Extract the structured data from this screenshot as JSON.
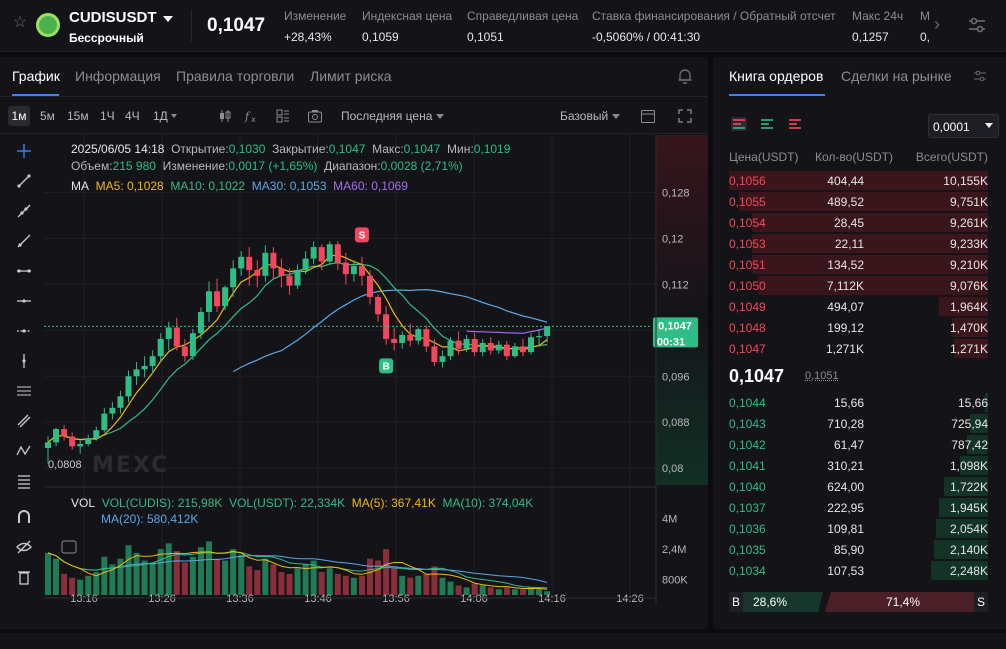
{
  "header": {
    "symbol": "CUDISUSDT",
    "contract_type": "Бессрочный",
    "last_price": "0,1047",
    "stats": [
      {
        "label": "Изменение",
        "value": "+28,43%",
        "color": "green"
      },
      {
        "label": "Индексная цена",
        "value": "0,1059",
        "color": "normal"
      },
      {
        "label": "Справедливая цена",
        "value": "0,1051",
        "color": "normal"
      },
      {
        "label": "Ставка финансирования / Обратный отсчет",
        "value": "-0,5060% / 00:41:30",
        "color": "normal"
      },
      {
        "label": "Макс 24ч",
        "value": "0,1257",
        "color": "normal"
      },
      {
        "label": "М",
        "value": "0,",
        "color": "normal"
      }
    ]
  },
  "left_tabs": [
    "График",
    "Информация",
    "Правила торговли",
    "Лимит риска"
  ],
  "toolbar": {
    "timeframes": [
      "1м",
      "5м",
      "15м",
      "1Ч",
      "4Ч",
      "1Д"
    ],
    "price_type": "Последняя цена",
    "view_mode": "Базовый"
  },
  "chart_info": {
    "line1": {
      "date": "2025/06/05 14:18",
      "open_label": "Открытие:",
      "open": "0,1030",
      "close_label": "Закрытие:",
      "close": "0,1047",
      "high_label": "Макс:",
      "high": "0,1047",
      "low_label": "Мин:",
      "low": "0,1019"
    },
    "line2": {
      "vol_label": "Объем:",
      "vol": "215 980",
      "chg_label": "Изменение:",
      "chg": "0,0017 (+1,65%)",
      "amp_label": "Диапазон:",
      "amp": "0,0028 (2,71%)"
    },
    "ma": {
      "label": "MA",
      "ma5": "MA5: 0,1028",
      "ma10": "MA10: 0,1022",
      "ma30": "MA30: 0,1053",
      "ma60": "MA60: 0,1069"
    },
    "vol_line1": {
      "label": "VOL",
      "vol_base": "VOL(CUDIS): 215,98K",
      "vol_quote": "VOL(USDT): 22,334K",
      "ma5": "MA(5): 367,41K",
      "ma10": "MA(10): 374,04K"
    },
    "vol_line2": {
      "ma20": "MA(20): 580,412K"
    },
    "watermark": "MEXC",
    "current_price_tag": "0,1047",
    "countdown_tag": "00:31",
    "low_marker": "0,0808",
    "sell_marker": "S",
    "buy_marker": "B"
  },
  "chart_data": {
    "type": "candlestick",
    "y_ticks": [
      "0,128",
      "0,12",
      "0,112",
      "0,104",
      "0,096",
      "0,088",
      "0,08"
    ],
    "y_tick_values": [
      0.128,
      0.12,
      0.112,
      0.104,
      0.096,
      0.088,
      0.08
    ],
    "vol_ticks": [
      "4M",
      "2,4M",
      "800K"
    ],
    "x_ticks": [
      "13:16",
      "13:26",
      "13:36",
      "13:46",
      "13:56",
      "14:06",
      "14:16",
      "14:26"
    ],
    "ylim": [
      0.0788,
      0.1328
    ],
    "candles": [
      [
        0.0835,
        0.0855,
        0.0845,
        0.0808
      ],
      [
        0.0845,
        0.087,
        0.0868,
        0.0838
      ],
      [
        0.0868,
        0.0875,
        0.0855,
        0.0848
      ],
      [
        0.0855,
        0.0862,
        0.0838,
        0.0832
      ],
      [
        0.0838,
        0.0848,
        0.0842,
        0.0825
      ],
      [
        0.0842,
        0.0858,
        0.0852,
        0.0838
      ],
      [
        0.0852,
        0.0872,
        0.0866,
        0.0848
      ],
      [
        0.0866,
        0.0905,
        0.0895,
        0.0862
      ],
      [
        0.0895,
        0.0915,
        0.0905,
        0.0885
      ],
      [
        0.0905,
        0.0935,
        0.0925,
        0.0895
      ],
      [
        0.0925,
        0.097,
        0.096,
        0.0915
      ],
      [
        0.096,
        0.0985,
        0.0972,
        0.0945
      ],
      [
        0.0972,
        0.0995,
        0.0978,
        0.0958
      ],
      [
        0.0978,
        0.1005,
        0.0995,
        0.0965
      ],
      [
        0.0995,
        0.1035,
        0.1025,
        0.0985
      ],
      [
        0.1025,
        0.1055,
        0.1045,
        0.1005
      ],
      [
        0.1045,
        0.1062,
        0.1012,
        0.1005
      ],
      [
        0.1012,
        0.1025,
        0.0995,
        0.0985
      ],
      [
        0.0995,
        0.1042,
        0.1035,
        0.0988
      ],
      [
        0.1035,
        0.108,
        0.1072,
        0.1025
      ],
      [
        0.1072,
        0.1125,
        0.1108,
        0.1055
      ],
      [
        0.1108,
        0.113,
        0.1082,
        0.1072
      ],
      [
        0.1082,
        0.1118,
        0.1115,
        0.1075
      ],
      [
        0.1115,
        0.1162,
        0.1148,
        0.1098
      ],
      [
        0.1148,
        0.1178,
        0.1168,
        0.1135
      ],
      [
        0.1168,
        0.1185,
        0.1145,
        0.1118
      ],
      [
        0.1145,
        0.1162,
        0.1135,
        0.1115
      ],
      [
        0.1135,
        0.1188,
        0.1175,
        0.1125
      ],
      [
        0.1175,
        0.1185,
        0.1148,
        0.1128
      ],
      [
        0.1148,
        0.1165,
        0.1135,
        0.1115
      ],
      [
        0.1135,
        0.1148,
        0.1118,
        0.1102
      ],
      [
        0.1118,
        0.1155,
        0.1145,
        0.1112
      ],
      [
        0.1145,
        0.1178,
        0.1165,
        0.1138
      ],
      [
        0.1165,
        0.1195,
        0.1185,
        0.1155
      ],
      [
        0.1185,
        0.119,
        0.116,
        0.1145
      ],
      [
        0.116,
        0.1195,
        0.119,
        0.1155
      ],
      [
        0.119,
        0.1195,
        0.1158,
        0.1145
      ],
      [
        0.1158,
        0.1175,
        0.1138,
        0.112
      ],
      [
        0.1138,
        0.1162,
        0.1152,
        0.1125
      ],
      [
        0.1152,
        0.1168,
        0.1135,
        0.1118
      ],
      [
        0.1135,
        0.1145,
        0.1098,
        0.1085
      ],
      [
        0.1098,
        0.1102,
        0.1068,
        0.1055
      ],
      [
        0.1068,
        0.1082,
        0.1025,
        0.1015
      ],
      [
        0.1025,
        0.1045,
        0.1018,
        0.1005
      ],
      [
        0.1018,
        0.1038,
        0.1032,
        0.1008
      ],
      [
        0.1032,
        0.1052,
        0.1022,
        0.1012
      ],
      [
        0.1022,
        0.1045,
        0.1042,
        0.1015
      ],
      [
        0.1042,
        0.1048,
        0.1012,
        0.1002
      ],
      [
        0.1012,
        0.1025,
        0.0985,
        0.0978
      ],
      [
        0.0985,
        0.1005,
        0.0995,
        0.0975
      ],
      [
        0.0995,
        0.1028,
        0.1022,
        0.0988
      ],
      [
        0.1022,
        0.1038,
        0.1008,
        0.0998
      ],
      [
        0.1008,
        0.1032,
        0.1025,
        0.1002
      ],
      [
        0.1025,
        0.1035,
        0.1002,
        0.0995
      ],
      [
        0.1002,
        0.1025,
        0.1018,
        0.0995
      ],
      [
        0.1018,
        0.1028,
        0.1005,
        0.0998
      ],
      [
        0.1005,
        0.1022,
        0.1015,
        0.0999
      ],
      [
        0.1015,
        0.1022,
        0.0995,
        0.0988
      ],
      [
        0.0995,
        0.1018,
        0.1012,
        0.0992
      ],
      [
        0.1012,
        0.1025,
        0.1002,
        0.0995
      ],
      [
        0.1002,
        0.1035,
        0.1028,
        0.0998
      ],
      [
        0.1028,
        0.1042,
        0.103,
        0.1015
      ],
      [
        0.103,
        0.1047,
        0.1047,
        0.1019
      ]
    ],
    "volumes": [
      2.2,
      1.9,
      1.1,
      0.9,
      0.8,
      1.0,
      1.2,
      2.0,
      1.6,
      1.9,
      2.6,
      2.2,
      1.8,
      1.7,
      2.4,
      2.7,
      2.3,
      1.7,
      2.0,
      2.5,
      2.8,
      1.9,
      1.8,
      2.4,
      2.1,
      1.5,
      1.3,
      1.9,
      1.6,
      1.2,
      1.1,
      1.4,
      1.6,
      1.8,
      1.2,
      1.4,
      1.1,
      1.0,
      0.9,
      1.0,
      1.9,
      1.8,
      2.4,
      1.4,
      1.0,
      0.9,
      1.0,
      1.1,
      1.5,
      0.9,
      0.7,
      0.5,
      0.4,
      0.6,
      0.5,
      0.4,
      0.3,
      0.4,
      0.3,
      0.3,
      0.4,
      0.3,
      0.2
    ],
    "ma_colors": {
      "ma5": "#f0b90b",
      "ma10": "#2ebd85",
      "ma30": "#5aa7e8",
      "ma60": "#a66bf0"
    }
  },
  "orderbook": {
    "tab_orderbook": "Книга ордеров",
    "tab_trades": "Сделки на рынке",
    "tick_size": "0,0001",
    "headers": {
      "price": "Цена(USDT)",
      "qty": "Кол-во(USDT)",
      "total": "Всего(USDT)"
    },
    "asks": [
      {
        "p": "0,1056",
        "q": "404,44",
        "t": "10,155K",
        "d": 1.0
      },
      {
        "p": "0,1055",
        "q": "489,52",
        "t": "9,751K",
        "d": 0.96
      },
      {
        "p": "0,1054",
        "q": "28,45",
        "t": "9,261K",
        "d": 0.91
      },
      {
        "p": "0,1053",
        "q": "22,11",
        "t": "9,233K",
        "d": 0.91
      },
      {
        "p": "0,1051",
        "q": "134,52",
        "t": "9,210K",
        "d": 0.91
      },
      {
        "p": "0,1050",
        "q": "7,112K",
        "t": "9,076K",
        "d": 0.89
      },
      {
        "p": "0,1049",
        "q": "494,07",
        "t": "1,964K",
        "d": 0.19
      },
      {
        "p": "0,1048",
        "q": "199,12",
        "t": "1,470K",
        "d": 0.14
      },
      {
        "p": "0,1047",
        "q": "1,271K",
        "t": "1,271K",
        "d": 0.13
      }
    ],
    "mid_price": "0,1047",
    "mid_fair": "0,1051",
    "bids": [
      {
        "p": "0,1044",
        "q": "15,66",
        "t": "15,66",
        "d": 0.01
      },
      {
        "p": "0,1043",
        "q": "710,28",
        "t": "725,94",
        "d": 0.07
      },
      {
        "p": "0,1042",
        "q": "61,47",
        "t": "787,42",
        "d": 0.08
      },
      {
        "p": "0,1041",
        "q": "310,21",
        "t": "1,098K",
        "d": 0.11
      },
      {
        "p": "0,1040",
        "q": "624,00",
        "t": "1,722K",
        "d": 0.17
      },
      {
        "p": "0,1037",
        "q": "222,95",
        "t": "1,945K",
        "d": 0.19
      },
      {
        "p": "0,1036",
        "q": "109,81",
        "t": "2,054K",
        "d": 0.2
      },
      {
        "p": "0,1035",
        "q": "85,90",
        "t": "2,140K",
        "d": 0.21
      },
      {
        "p": "0,1034",
        "q": "107,53",
        "t": "2,248K",
        "d": 0.22
      }
    ],
    "ratio": {
      "buy_label": "B",
      "buy": "28,6%",
      "sell": "71,4%",
      "sell_label": "S"
    }
  },
  "colors": {
    "green": "#2ebd85",
    "red": "#f6465d",
    "accent": "#3b82f6"
  }
}
